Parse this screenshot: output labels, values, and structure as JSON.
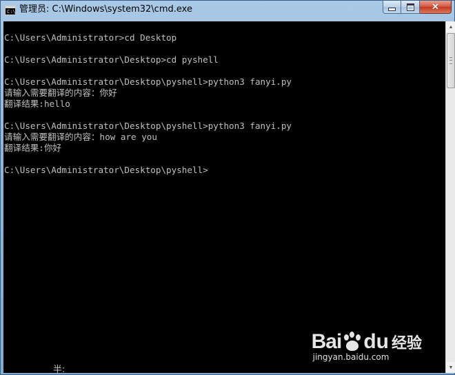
{
  "window": {
    "title": "管理员: C:\\Windows\\system32\\cmd.exe",
    "icon_label": "C:\\",
    "close_glyph": "✕"
  },
  "console": {
    "lines": [
      "C:\\Users\\Administrator>cd Desktop",
      "",
      "C:\\Users\\Administrator\\Desktop>cd pyshell",
      "",
      "C:\\Users\\Administrator\\Desktop\\pyshell>python3 fanyi.py",
      "请输入需要翻译的内容：你好",
      "翻译结果:hello",
      "",
      "C:\\Users\\Administrator\\Desktop\\pyshell>python3 fanyi.py",
      "请输入需要翻译的内容：how are you",
      "翻译结果:你好",
      "",
      "C:\\Users\\Administrator\\Desktop\\pyshell>"
    ],
    "ime_status": "半:"
  },
  "scrollbar": {
    "up_glyph": "▲",
    "down_glyph": "▼"
  },
  "watermark": {
    "brand_left": "Bai",
    "brand_right": "du",
    "brand_cn": "经验",
    "url": "jingyan.baidu.com"
  },
  "colors": {
    "console_bg": "#000000",
    "console_text": "#c0c0c0",
    "frame": "#8fb6da"
  }
}
